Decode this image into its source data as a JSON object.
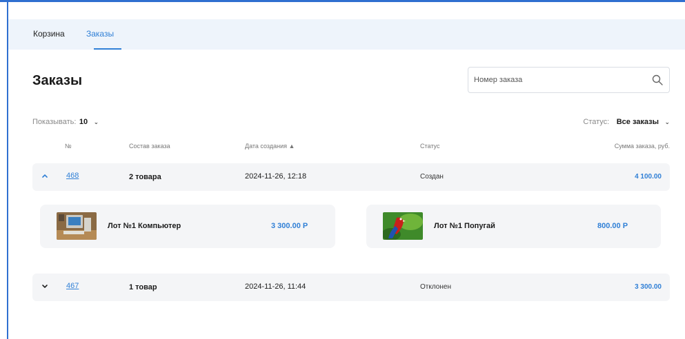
{
  "tabs": [
    {
      "label": "Корзина",
      "active": false
    },
    {
      "label": "Заказы",
      "active": true
    }
  ],
  "page": {
    "title": "Заказы"
  },
  "search": {
    "placeholder": "Номер заказа",
    "icon": "search-icon"
  },
  "filters": {
    "show_label": "Показывать:",
    "show_value": "10",
    "status_label": "Статус:",
    "status_value": "Все заказы"
  },
  "table": {
    "headers": {
      "number": "№",
      "contents": "Состав заказа",
      "created": "Дата создания ▲",
      "status": "Статус",
      "sum": "Сумма заказа, руб."
    },
    "orders": [
      {
        "number": "468",
        "items_count": "2 товара",
        "created": "2024-11-26, 12:18",
        "status": "Создан",
        "sum": "4 100.00",
        "expanded": true,
        "items": [
          {
            "name": "Лот №1 Компьютер",
            "price": "3 300.00 Р",
            "thumb": "computer-image"
          },
          {
            "name": "Лот №1 Попугай",
            "price": "800.00 Р",
            "thumb": "parrot-image"
          }
        ]
      },
      {
        "number": "467",
        "items_count": "1 товар",
        "created": "2024-11-26, 11:44",
        "status": "Отклонен",
        "sum": "3 300.00",
        "expanded": false
      }
    ]
  },
  "colors": {
    "accent": "#2f7fd6",
    "tab_bar_bg": "#eef4fb",
    "row_bg": "#f4f5f7"
  }
}
